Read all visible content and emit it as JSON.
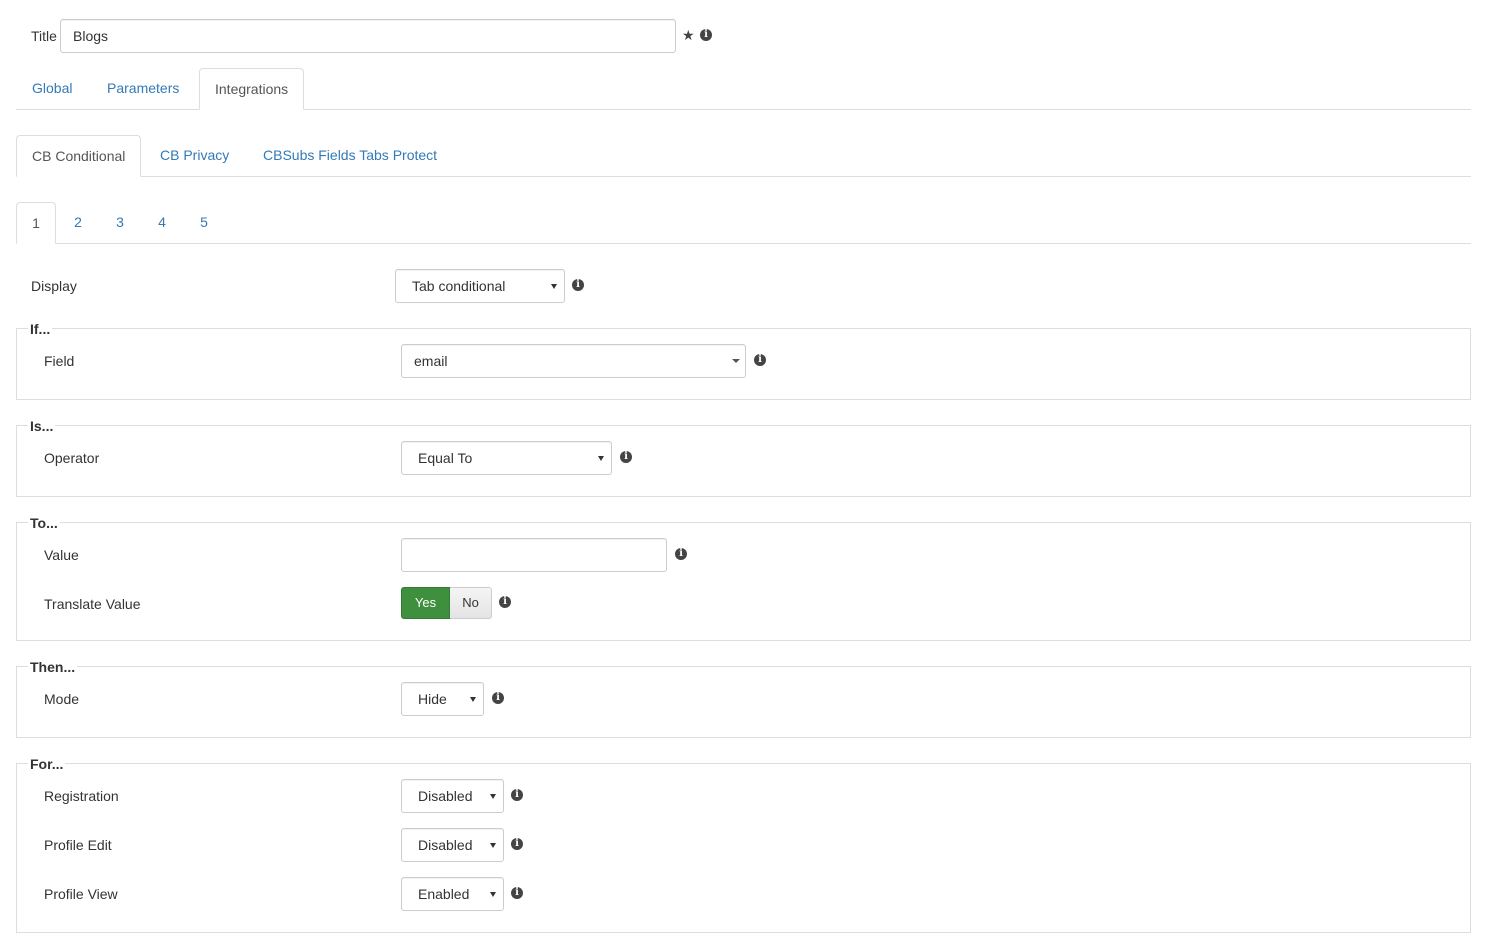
{
  "title_row": {
    "label": "Title",
    "value": "Blogs",
    "star_glyph": "★",
    "info_glyph": "i"
  },
  "main_tabs": [
    {
      "label": "Global",
      "active": false
    },
    {
      "label": "Parameters",
      "active": false
    },
    {
      "label": "Integrations",
      "active": true
    }
  ],
  "integration_tabs": [
    {
      "label": "CB Conditional",
      "active": true
    },
    {
      "label": "CB Privacy",
      "active": false
    },
    {
      "label": "CBSubs Fields Tabs Protect",
      "active": false
    }
  ],
  "condition_tabs": [
    {
      "label": "1",
      "active": true
    },
    {
      "label": "2",
      "active": false
    },
    {
      "label": "3",
      "active": false
    },
    {
      "label": "4",
      "active": false
    },
    {
      "label": "5",
      "active": false
    }
  ],
  "display": {
    "label": "Display",
    "value": "Tab conditional"
  },
  "if_section": {
    "legend": "If...",
    "field_label": "Field",
    "field_value": "email"
  },
  "is_section": {
    "legend": "Is...",
    "operator_label": "Operator",
    "operator_value": "Equal To"
  },
  "to_section": {
    "legend": "To...",
    "value_label": "Value",
    "value_value": "",
    "translate_label": "Translate Value",
    "yes_label": "Yes",
    "no_label": "No",
    "translate_selected": "Yes"
  },
  "then_section": {
    "legend": "Then...",
    "mode_label": "Mode",
    "mode_value": "Hide"
  },
  "for_section": {
    "legend": "For...",
    "registration_label": "Registration",
    "registration_value": "Disabled",
    "profile_edit_label": "Profile Edit",
    "profile_edit_value": "Disabled",
    "profile_view_label": "Profile View",
    "profile_view_value": "Enabled"
  },
  "colors": {
    "link": "#337ab7",
    "active_tab_text": "#555555",
    "border": "#dddddd",
    "yes_button": "#3e8f3e"
  },
  "icons": [
    "star-icon",
    "info-icon",
    "caret-down-icon"
  ]
}
